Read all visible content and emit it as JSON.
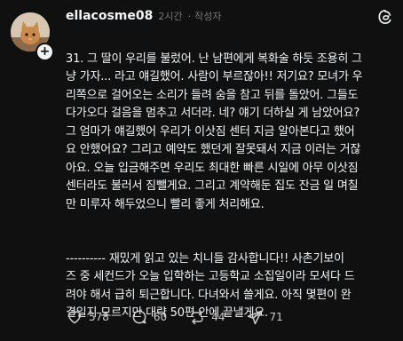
{
  "post": {
    "username": "ellacosme08",
    "time_ago": "2시간",
    "author_tag": "작성자",
    "paragraphs": [
      "31. 그 딸이 우리를 불렀어. 난 남편에게 복화술 하듯 조용히 그\n냥 가자... 라고 얘길했어. 사람이 부르잖아!! 저기요? 모녀가 우\n리쪽으로 걸어오는 소리가 들려 숨을 참고 뒤를 돌았어. 그들도\n다가오다 걸음을 멈추고 서더라. 네? 얘기 더하실 게 남았어요?\n그 엄마가 얘길했어 우리가 이삿짐 센터 지금 알아본다고 했어\n요 안했어요? 그리고 예약도 했던게 잘못돼서 지금 이러는 거잖\n아요. 오늘 입금해주면 우리도 최대한 빠른 시일에 아무 이삿짐\n센터라도 불러서 짐뺄게요. 그리고 계약해둔 집도 잔금 일 며칠\n만 미루자 해두었으니 빨리 좋게 처리해요.",
      "---------- 재밌게 읽고 있는 치니들 감사합니다!! 사촌기보이\n즈 중 세컨드가 오늘 입학하는 고등학교 소집일이라 모셔다 드\n려야 해서 급히 퇴근합니다. 다녀와서 쓸게요. 아직 몇편이 완\n결일지 모르지만 대략 50편 안에 끝낼게요."
    ]
  },
  "actions": {
    "likes": "578",
    "comments": "60",
    "reposts": "44",
    "shares": "71"
  },
  "icons": {
    "avatar": "cat-photo-avatar",
    "follow": "plus-icon",
    "brand": "threads-logo-icon",
    "like": "heart-icon",
    "comment": "comment-icon",
    "repost": "repost-icon",
    "share": "send-icon"
  },
  "colors": {
    "background": "#101010",
    "text": "#f3f5f7",
    "muted": "#777777"
  }
}
